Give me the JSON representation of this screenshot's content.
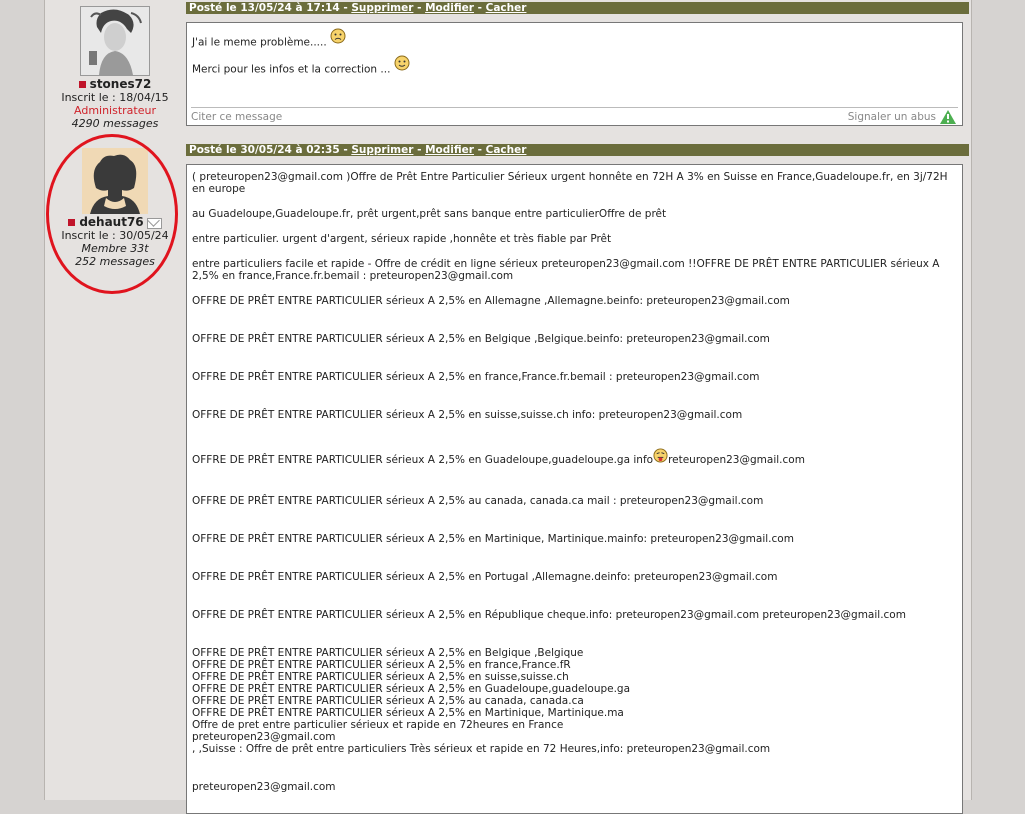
{
  "user1": {
    "name": "stones72",
    "joined": "Inscrit le : 18/04/15",
    "role": "Administrateur",
    "messages": "4290 messages"
  },
  "user2": {
    "name": "dehaut76",
    "joined": "Inscrit le : 30/05/24",
    "rank": "Membre 33t",
    "messages": "252 messages"
  },
  "post1": {
    "date": "Posté le 13/05/24 à 17:14",
    "delete": "Supprimer",
    "edit": "Modifier",
    "hide": "Cacher",
    "line1": "J'ai le meme problème.....",
    "line2": "Merci pour les infos et la correction ...",
    "quote": "Citer ce message",
    "report": "Signaler un abus"
  },
  "post2": {
    "date": "Posté le 30/05/24 à 02:35",
    "delete": "Supprimer",
    "edit": "Modifier",
    "hide": "Cacher",
    "para1": "( preteuropen23@gmail.com )Offre de Prêt Entre Particulier Sérieux urgent honnête en 72H A 3% en Suisse en France,Guadeloupe.fr, en 3j/72H en europe",
    "para2": "au Guadeloupe,Guadeloupe.fr, prêt urgent,prêt sans banque entre particulierOffre de prêt",
    "para3": "entre particulier. urgent d'argent, sérieux rapide ,honnête et très fiable par Prêt",
    "para4": " entre particuliers facile et rapide - Offre de crédit en ligne sérieux preteuropen23@gmail.com !!OFFRE DE PRÊT ENTRE PARTICULIER sérieux A 2,5% en france,France.fr.bemail : preteuropen23@gmail.com",
    "offers": [
      "OFFRE DE PRÊT ENTRE PARTICULIER sérieux A 2,5% en Allemagne ,Allemagne.beinfo: preteuropen23@gmail.com",
      "OFFRE DE PRÊT ENTRE PARTICULIER sérieux A 2,5% en Belgique ,Belgique.beinfo: preteuropen23@gmail.com",
      "OFFRE DE PRÊT ENTRE PARTICULIER sérieux A 2,5% en france,France.fr.bemail : preteuropen23@gmail.com",
      "OFFRE DE PRÊT ENTRE PARTICULIER sérieux A 2,5% en suisse,suisse.ch info: preteuropen23@gmail.com",
      "OFFRE DE PRÊT ENTRE PARTICULIER sérieux A 2,5% en Guadeloupe,guadeloupe.ga info",
      "OFFRE DE PRÊT ENTRE PARTICULIER sérieux A 2,5% au canada, canada.ca mail : preteuropen23@gmail.com",
      "OFFRE DE PRÊT ENTRE PARTICULIER sérieux A 2,5% en Martinique, Martinique.mainfo: preteuropen23@gmail.com",
      "OFFRE DE PRÊT ENTRE PARTICULIER sérieux A 2,5% en Portugal ,Allemagne.deinfo: preteuropen23@gmail.com",
      "OFFRE DE PRÊT ENTRE PARTICULIER sérieux A 2,5% en République cheque.info: preteuropen23@gmail.com preteuropen23@gmail.com"
    ],
    "guadeloupe_tail": "reteuropen23@gmail.com",
    "block": [
      "OFFRE DE PRÊT ENTRE PARTICULIER sérieux A 2,5% en Belgique ,Belgique",
      "OFFRE DE PRÊT ENTRE PARTICULIER sérieux A 2,5% en france,France.fR",
      "OFFRE DE PRÊT ENTRE PARTICULIER sérieux A 2,5% en suisse,suisse.ch",
      "OFFRE DE PRÊT ENTRE PARTICULIER sérieux A 2,5% en Guadeloupe,guadeloupe.ga",
      "OFFRE DE PRÊT ENTRE PARTICULIER sérieux A 2,5% au canada, canada.ca",
      "OFFRE DE PRÊT ENTRE PARTICULIER sérieux A 2,5% en Martinique, Martinique.ma",
      "Offre de pret entre particulier sérieux et rapide en 72heures en France",
      "preteuropen23@gmail.com",
      ", ,Suisse : Offre de prêt entre particuliers Très sérieux et rapide en 72 Heures,info: preteuropen23@gmail.com"
    ],
    "last": "preteuropen23@gmail.com"
  }
}
